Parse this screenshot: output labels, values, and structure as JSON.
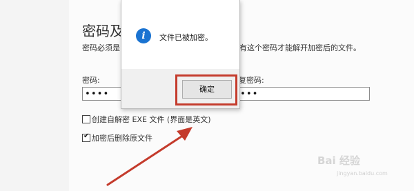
{
  "settings": {
    "section_title": "密码及",
    "description_left": "密码必须是",
    "description_right": "有这个密码才能解开加密后的文件。",
    "password_label": "密码:",
    "password_value": "••••",
    "confirm_label": "复密码:",
    "confirm_value": "•••",
    "checkbox_sfx": {
      "label": "创建自解密 EXE 文件 (界面是英文)",
      "checked": false
    },
    "checkbox_delete": {
      "label": "加密后删除原文件",
      "checked": true
    }
  },
  "messagebox": {
    "title": "",
    "icon": "info-icon",
    "message": "文件已被加密。",
    "ok_label": "确定"
  },
  "annotation": {
    "highlight_color": "#c43b2c",
    "arrow_color": "#c43b2c"
  },
  "watermark": {
    "text": "Bai 经验",
    "sub": "jingyan.baidu.com"
  }
}
